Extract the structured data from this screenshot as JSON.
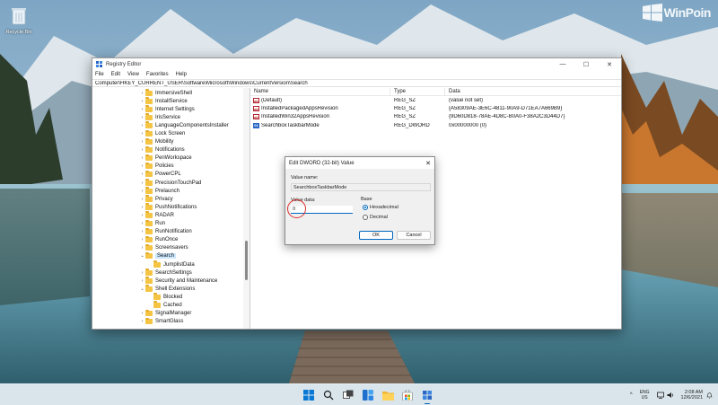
{
  "desktop": {
    "recycle_bin_label": "Recycle Bin",
    "watermark_text": "WinPoin"
  },
  "regedit": {
    "title": "Registry Editor",
    "window_controls": {
      "minimize": "—",
      "maximize": "☐",
      "close": "✕"
    },
    "menu": [
      "File",
      "Edit",
      "View",
      "Favorites",
      "Help"
    ],
    "address": "Computer\\HKEY_CURRENT_USER\\Software\\Microsoft\\Windows\\CurrentVersion\\Search",
    "tree": [
      {
        "label": "ImmersiveShell",
        "chevron": "›",
        "selected": false,
        "indent": 0
      },
      {
        "label": "InstallService",
        "chevron": "›",
        "selected": false,
        "indent": 0
      },
      {
        "label": "Internet Settings",
        "chevron": "›",
        "selected": false,
        "indent": 0
      },
      {
        "label": "IrisService",
        "chevron": "›",
        "selected": false,
        "indent": 0
      },
      {
        "label": "LanguageComponentsInstaller",
        "chevron": "›",
        "selected": false,
        "indent": 0
      },
      {
        "label": "Lock Screen",
        "chevron": "›",
        "selected": false,
        "indent": 0
      },
      {
        "label": "Mobility",
        "chevron": "›",
        "selected": false,
        "indent": 0
      },
      {
        "label": "Notifications",
        "chevron": "›",
        "selected": false,
        "indent": 0
      },
      {
        "label": "PenWorkspace",
        "chevron": "›",
        "selected": false,
        "indent": 0
      },
      {
        "label": "Policies",
        "chevron": "›",
        "selected": false,
        "indent": 0
      },
      {
        "label": "PowerCPL",
        "chevron": "›",
        "selected": false,
        "indent": 0
      },
      {
        "label": "PrecisionTouchPad",
        "chevron": "›",
        "selected": false,
        "indent": 0
      },
      {
        "label": "Prelaunch",
        "chevron": "›",
        "selected": false,
        "indent": 0
      },
      {
        "label": "Privacy",
        "chevron": "›",
        "selected": false,
        "indent": 0
      },
      {
        "label": "PushNotifications",
        "chevron": "›",
        "selected": false,
        "indent": 0
      },
      {
        "label": "RADAR",
        "chevron": "›",
        "selected": false,
        "indent": 0
      },
      {
        "label": "Run",
        "chevron": "›",
        "selected": false,
        "indent": 0
      },
      {
        "label": "RunNotification",
        "chevron": "›",
        "selected": false,
        "indent": 0
      },
      {
        "label": "RunOnce",
        "chevron": "›",
        "selected": false,
        "indent": 0
      },
      {
        "label": "Screensavers",
        "chevron": "›",
        "selected": false,
        "indent": 0
      },
      {
        "label": "Search",
        "chevron": "⌄",
        "selected": true,
        "indent": 0
      },
      {
        "label": "JumplistData",
        "chevron": "",
        "selected": false,
        "indent": 1
      },
      {
        "label": "SearchSettings",
        "chevron": "›",
        "selected": false,
        "indent": 0
      },
      {
        "label": "Security and Maintenance",
        "chevron": "›",
        "selected": false,
        "indent": 0
      },
      {
        "label": "Shell Extensions",
        "chevron": "⌄",
        "selected": false,
        "indent": 0
      },
      {
        "label": "Blocked",
        "chevron": "",
        "selected": false,
        "indent": 1
      },
      {
        "label": "Cached",
        "chevron": "",
        "selected": false,
        "indent": 1
      },
      {
        "label": "SignalManager",
        "chevron": "›",
        "selected": false,
        "indent": 0
      },
      {
        "label": "SmartGlass",
        "chevron": "›",
        "selected": false,
        "indent": 0
      }
    ],
    "columns": {
      "name": "Name",
      "type": "Type",
      "data": "Data"
    },
    "values": [
      {
        "name": "(Default)",
        "type": "REG_SZ",
        "data": "(value not set)",
        "icon": "string-value-icon"
      },
      {
        "name": "InstalledPackagedAppsRevision",
        "type": "REG_SZ",
        "data": "{A58309AE-3E6C-4811-90A9-D71EA7A669B9}",
        "icon": "string-value-icon"
      },
      {
        "name": "InstalledWin32AppsRevision",
        "type": "REG_SZ",
        "data": "{9D60D818-78AE-4D8C-B0A0-F38A2C3D44D7}",
        "icon": "string-value-icon"
      },
      {
        "name": "SearchboxTaskbarMode",
        "type": "REG_DWORD",
        "data": "0x00000000 (0)",
        "icon": "dword-value-icon"
      }
    ]
  },
  "dialog": {
    "title": "Edit DWORD (32-bit) Value",
    "close": "✕",
    "value_name_label": "Value name:",
    "value_name": "SearchboxTaskbarMode",
    "value_data_label": "Value data:",
    "value_data": "0",
    "base_label": "Base",
    "base_options": [
      {
        "label": "Hexadecimal",
        "selected": true
      },
      {
        "label": "Decimal",
        "selected": false
      }
    ],
    "ok_label": "OK",
    "cancel_label": "Cancel",
    "highlight_color": "#d9302c"
  },
  "taskbar": {
    "icons": [
      "start-icon",
      "search-icon",
      "task-view-icon",
      "widgets-icon",
      "file-explorer-icon",
      "store-icon",
      "registry-editor-icon"
    ],
    "tray_chevron": "^",
    "language_line1": "ENG",
    "language_line2": "US",
    "time": "2:08 AM",
    "date": "12/6/2021"
  },
  "colors": {
    "accent": "#0067c0",
    "folder": "#f5c445"
  }
}
